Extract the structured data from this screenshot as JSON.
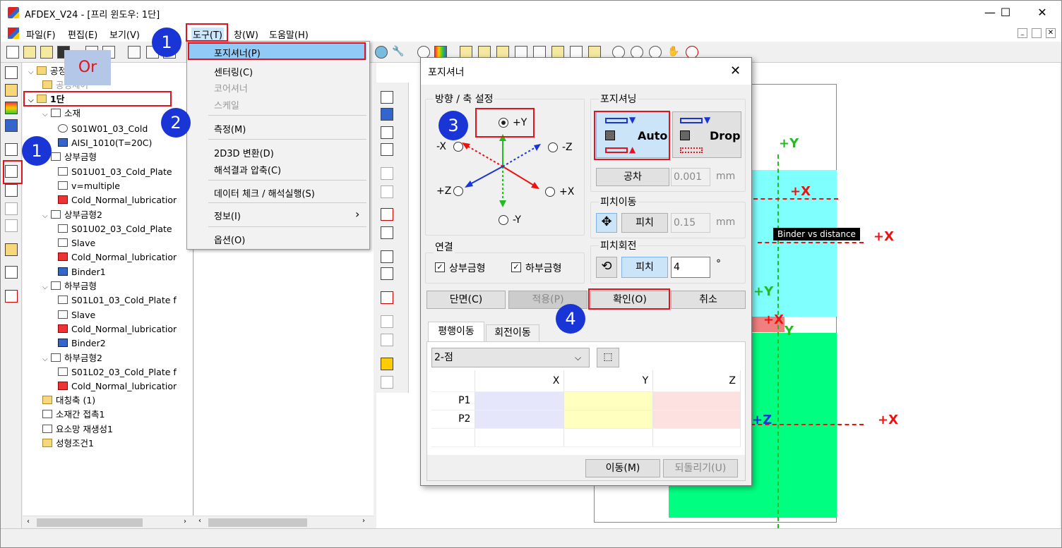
{
  "window": {
    "title": "AFDEX_V24 - [프리 윈도우: 1단]",
    "minimize": "—",
    "maximize": "☐",
    "close": "✕"
  },
  "menubar": {
    "items": [
      "파일(F)",
      "편집(E)",
      "보기(V)",
      "도구(T)",
      "창(W)",
      "도움말(H)"
    ]
  },
  "tools_menu": {
    "items": [
      "포지셔너(P)",
      "센터링(C)",
      "코어셔너",
      "스케일",
      "측정(M)",
      "2D3D 변환(D)",
      "해석결과 압축(C)",
      "데이터 체크 / 해석실행(S)",
      "정보(I)",
      "옵션(O)"
    ],
    "info_submenu_arrow": "›"
  },
  "tree": {
    "items": [
      {
        "label": "공정",
        "level": 0
      },
      {
        "label": "공정체어",
        "level": 1
      },
      {
        "label": "1단",
        "level": 0
      },
      {
        "label": "소재",
        "level": 1
      },
      {
        "label": "S01W01_03_Cold",
        "level": 2
      },
      {
        "label": "AISI_1010(T=20C)",
        "level": 2
      },
      {
        "label": "상부금형",
        "level": 1
      },
      {
        "label": "S01U01_03_Cold_Plate",
        "level": 2
      },
      {
        "label": "v=multiple",
        "level": 2
      },
      {
        "label": "Cold_Normal_lubricatior",
        "level": 2
      },
      {
        "label": "상부금형2",
        "level": 1
      },
      {
        "label": "S01U02_03_Cold_Plate",
        "level": 2
      },
      {
        "label": "Slave",
        "level": 2
      },
      {
        "label": "Cold_Normal_lubricatior",
        "level": 2
      },
      {
        "label": "Binder1",
        "level": 2
      },
      {
        "label": "하부금형",
        "level": 1
      },
      {
        "label": "S01L01_03_Cold_Plate f",
        "level": 2
      },
      {
        "label": "Slave",
        "level": 2
      },
      {
        "label": "Cold_Normal_lubricatior",
        "level": 2
      },
      {
        "label": "Binder2",
        "level": 2
      },
      {
        "label": "하부금형2",
        "level": 1
      },
      {
        "label": "S01L02_03_Cold_Plate f",
        "level": 2
      },
      {
        "label": "Cold_Normal_lubricatior",
        "level": 2
      },
      {
        "label": "대칭축 (1)",
        "level": 1
      },
      {
        "label": "소재간 접촉1",
        "level": 1
      },
      {
        "label": "요소망 재생성1",
        "level": 1
      },
      {
        "label": "성형조건1",
        "level": 1
      }
    ]
  },
  "annotations": {
    "or_label": "Or",
    "badges": [
      "1",
      "1",
      "2",
      "3",
      "4"
    ]
  },
  "dialog": {
    "title": "포지셔너",
    "close": "✕",
    "direction_group": "방향 / 축 설정",
    "radios": [
      "+Y",
      "-X",
      "-Z",
      "+Z",
      "+X",
      "-Y"
    ],
    "positioning_group": "포지셔닝",
    "auto_label": "Auto",
    "drop_label": "Drop",
    "tolerance_button": "공차",
    "tolerance_value": "0.001",
    "unit_mm": "mm",
    "pitch_move_group": "피치이동",
    "pitch_button": "피치",
    "pitch_value": "0.15",
    "pitch_rotate_group": "피치회전",
    "pitch_rotate_value": "4",
    "degree": "°",
    "connect_group": "연결",
    "connect_upper": "상부금형",
    "connect_lower": "하부금형",
    "section_button": "단면(C)",
    "apply_button": "적용(P)",
    "ok_button": "확인(O)",
    "cancel_button": "취소",
    "tabs": [
      "평행이동",
      "회전이동"
    ],
    "mode_select": "2-점",
    "table": {
      "headers": [
        "",
        "X",
        "Y",
        "Z"
      ],
      "rows": [
        "P1",
        "P2"
      ]
    },
    "move_button": "이동(M)",
    "undo_button": "되돌리기(U)"
  },
  "viewport": {
    "labels": [
      "+Y",
      "+X",
      "+X",
      "+Y",
      "+X",
      "Y",
      "+Z",
      "+X"
    ],
    "tooltip": "Binder vs distance"
  },
  "colors": {
    "highlight": "#e0141e",
    "badge": "#1a35d6",
    "cyan_part": "#80ffff",
    "green_part": "#00ff80",
    "axis_green": "#22bb22",
    "axis_red": "#ee1111"
  }
}
